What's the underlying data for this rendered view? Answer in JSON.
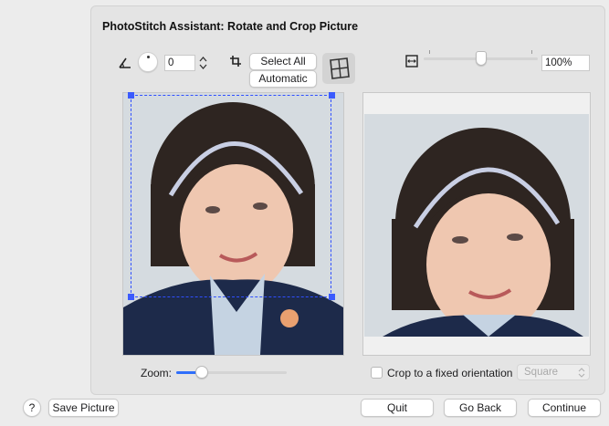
{
  "dialog": {
    "title": "PhotoStitch Assistant: Rotate and Crop Picture"
  },
  "toolbar": {
    "rotation_value": "0",
    "select_all_label": "Select All",
    "automatic_label": "Automatic",
    "zoom_percent": "100%",
    "scale_slider_level": 0.5
  },
  "zoom": {
    "label": "Zoom:",
    "level": 0.2
  },
  "crop_options": {
    "fixed_orientation_label": "Crop to a fixed orientation",
    "fixed_orientation_checked": false,
    "orientation_select_value": "Square"
  },
  "footer": {
    "help_label": "?",
    "save_picture_label": "Save Picture",
    "quit_label": "Quit",
    "go_back_label": "Go Back",
    "continue_label": "Continue"
  },
  "colors": {
    "accent": "#3b5bfd",
    "crop_line": "#2f4fff"
  }
}
